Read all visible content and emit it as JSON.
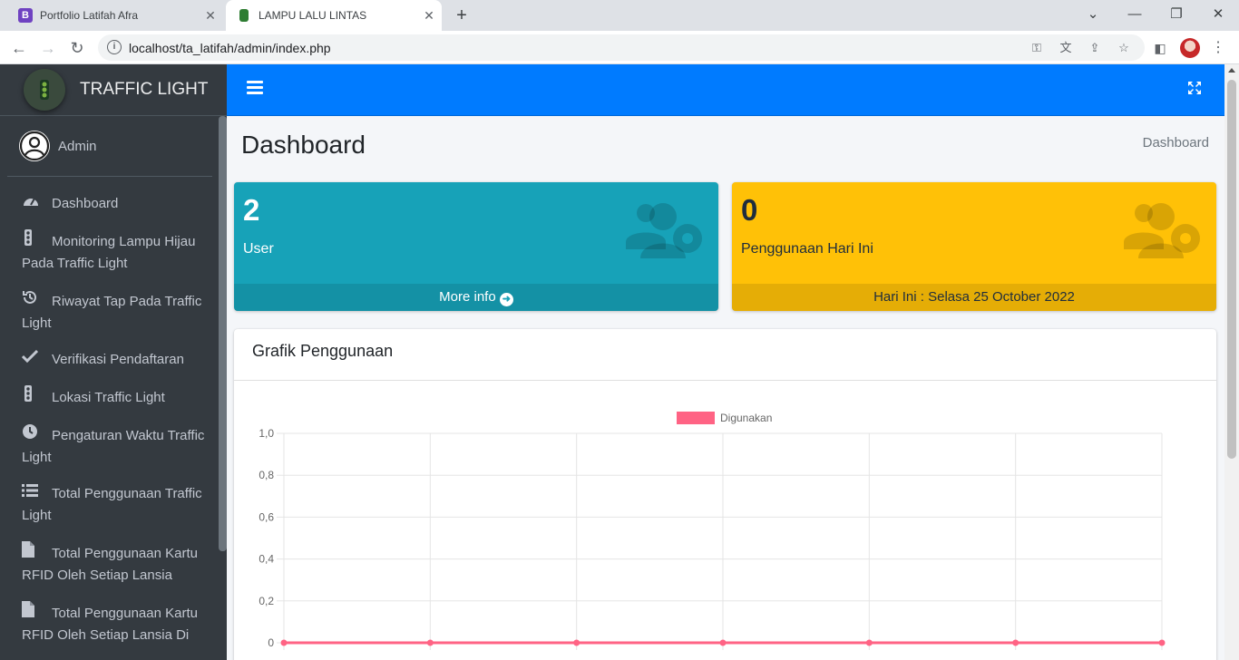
{
  "browser": {
    "tabs": [
      {
        "favicon": "B",
        "title": "Portfolio Latifah Afra",
        "close": "✕"
      },
      {
        "favicon": "traffic-light",
        "title": "LAMPU LALU LINTAS",
        "close": "✕"
      }
    ],
    "new_tab": "+",
    "url": "localhost/ta_latifah/admin/index.php"
  },
  "sidebar": {
    "brand": "TRAFFIC LIGHT",
    "user": "Admin",
    "items": [
      {
        "icon": "tachometer-icon",
        "label": "Dashboard"
      },
      {
        "icon": "traffic-light-icon",
        "label": "Monitoring Lampu Hijau Pada Traffic Light"
      },
      {
        "icon": "history-icon",
        "label": "Riwayat Tap Pada Traffic Light"
      },
      {
        "icon": "check-icon",
        "label": "Verifikasi Pendaftaran"
      },
      {
        "icon": "traffic-light-icon",
        "label": "Lokasi Traffic Light"
      },
      {
        "icon": "clock-icon",
        "label": "Pengaturan Waktu Traffic Light"
      },
      {
        "icon": "list-icon",
        "label": "Total Penggunaan Traffic Light"
      },
      {
        "icon": "file-icon",
        "label": "Total Penggunaan Kartu RFID Oleh Setiap Lansia"
      },
      {
        "icon": "file-icon",
        "label": "Total Penggunaan Kartu RFID Oleh Setiap Lansia Di"
      }
    ]
  },
  "content": {
    "title": "Dashboard",
    "breadcrumb": "Dashboard",
    "boxes": [
      {
        "value": "2",
        "label": "User",
        "footer": "More info",
        "color": "#17a2b8"
      },
      {
        "value": "0",
        "label": "Penggunaan Hari Ini",
        "footer": "Hari Ini : Selasa 25 October 2022",
        "color": "#ffc107"
      }
    ],
    "chart_card_title": "Grafik Penggunaan"
  },
  "chart_data": {
    "type": "line",
    "title": "",
    "xlabel": "",
    "ylabel": "",
    "x": [
      "",
      "",
      "",
      "",
      "",
      "",
      ""
    ],
    "series": [
      {
        "name": "Digunakan",
        "color": "#ff6384",
        "values": [
          0,
          0,
          0,
          0,
          0,
          0,
          0
        ]
      }
    ],
    "y_ticks": [
      "1,0",
      "0,8",
      "0,6",
      "0,4",
      "0,2",
      "0"
    ],
    "ylim": [
      0,
      1
    ],
    "grid": true,
    "legend_position": "top"
  }
}
